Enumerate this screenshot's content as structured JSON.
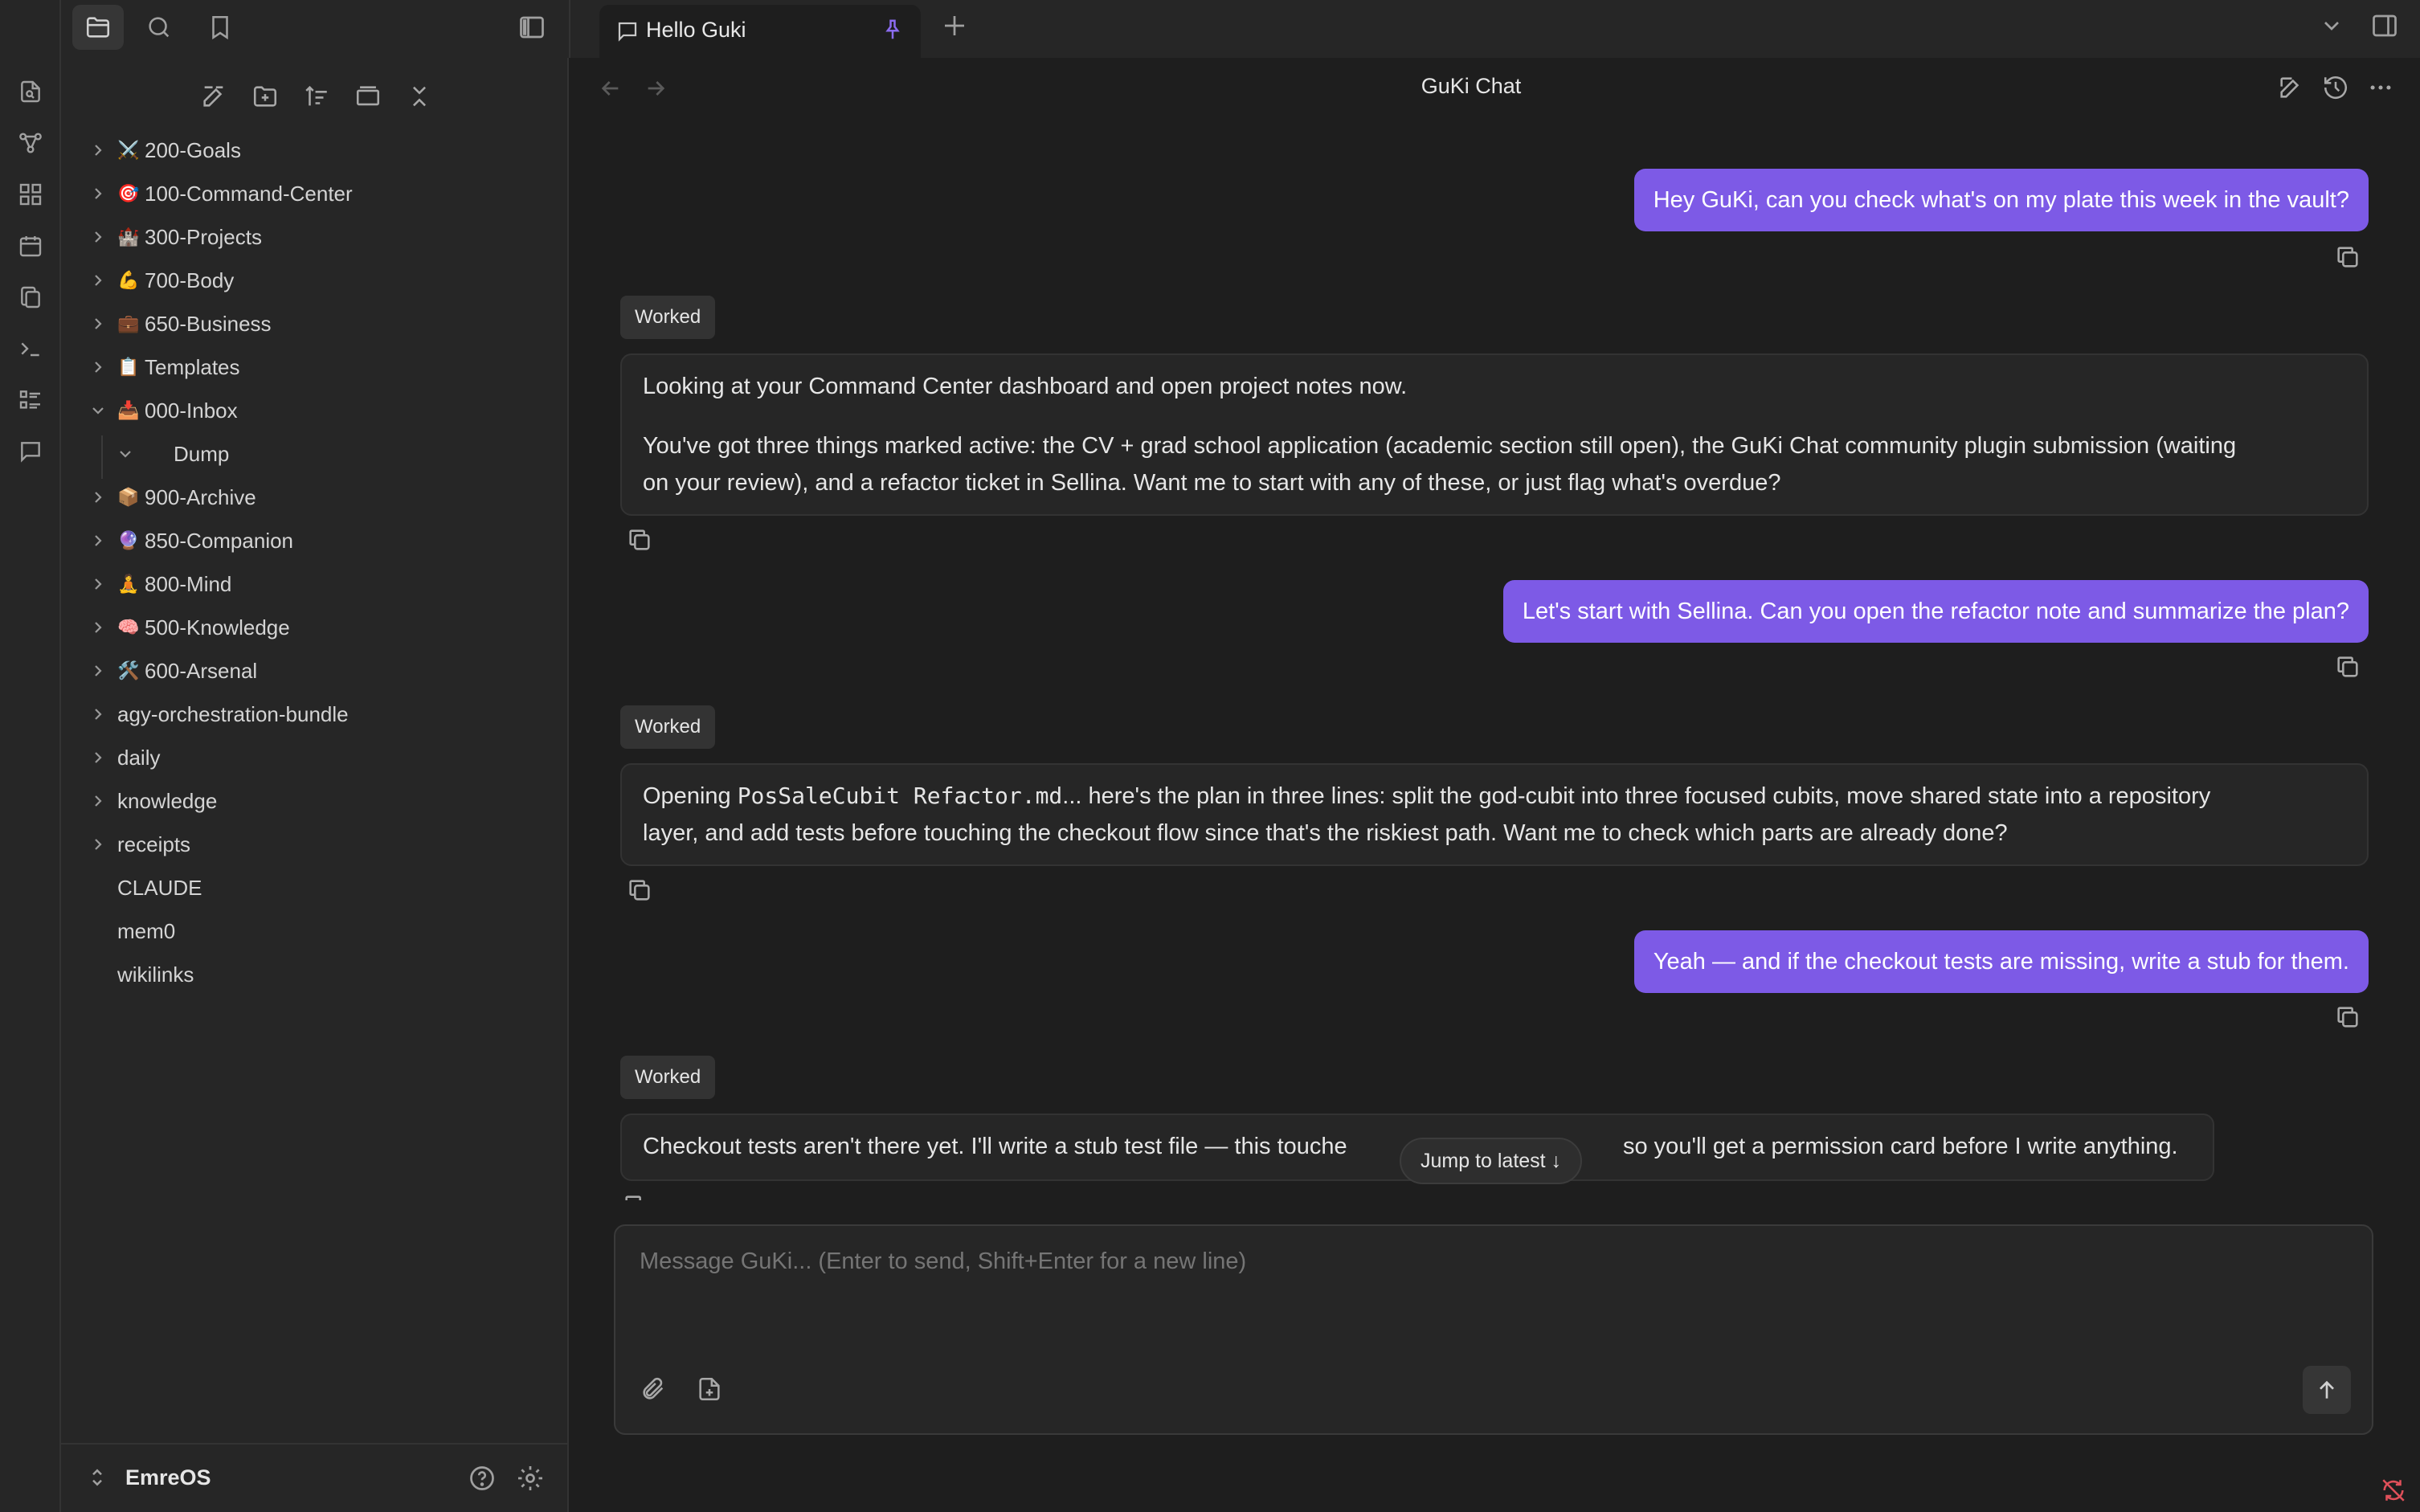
{
  "tabs": [
    {
      "label": "Hello Guki",
      "pinned": true
    }
  ],
  "header": {
    "title": "GuKi Chat"
  },
  "sidebar": {
    "items": [
      {
        "emoji": "⚔️",
        "label": "200-Goals",
        "expanded": false
      },
      {
        "emoji": "🎯",
        "label": "100-Command-Center",
        "expanded": false
      },
      {
        "emoji": "🏰",
        "label": "300-Projects",
        "expanded": false
      },
      {
        "emoji": "💪",
        "label": "700-Body",
        "expanded": false
      },
      {
        "emoji": "💼",
        "label": "650-Business",
        "expanded": false
      },
      {
        "emoji": "📋",
        "label": "Templates",
        "expanded": false
      },
      {
        "emoji": "📥",
        "label": "000-Inbox",
        "expanded": true
      },
      {
        "emoji": "",
        "label": "Dump",
        "expanded": true,
        "child": true
      },
      {
        "emoji": "📦",
        "label": "900-Archive",
        "expanded": false
      },
      {
        "emoji": "🔮",
        "label": "850-Companion",
        "expanded": false
      },
      {
        "emoji": "🧘",
        "label": "800-Mind",
        "expanded": false
      },
      {
        "emoji": "🧠",
        "label": "500-Knowledge",
        "expanded": false
      },
      {
        "emoji": "🛠️",
        "label": "600-Arsenal",
        "expanded": false
      },
      {
        "emoji": "",
        "label": "agy-orchestration-bundle",
        "expanded": false
      },
      {
        "emoji": "",
        "label": "daily",
        "expanded": false
      },
      {
        "emoji": "",
        "label": "knowledge",
        "expanded": false
      },
      {
        "emoji": "",
        "label": "receipts",
        "expanded": false
      },
      {
        "emoji": "",
        "label": "CLAUDE",
        "file": true
      },
      {
        "emoji": "",
        "label": "mem0",
        "file": true
      },
      {
        "emoji": "",
        "label": "wikilinks",
        "file": true
      }
    ]
  },
  "vault": {
    "name": "EmreOS"
  },
  "chat": {
    "messages": [
      {
        "role": "user",
        "text": "Hey GuKi, can you check what's on my plate this week in the vault?"
      },
      {
        "role": "assistant",
        "badge": "Worked",
        "p1": "Looking at your Command Center dashboard and open project notes now.",
        "p2a": "You've got three things marked active: the CV + grad school application (academic section still open), the GuKi Chat community plugin submission (waiting",
        "p2b": "on your review), and a refactor ticket in Sellina. Want me to start with any of these, or just flag what's overdue?"
      },
      {
        "role": "user",
        "text": "Let's start with Sellina. Can you open the refactor note and summarize the plan?"
      },
      {
        "role": "assistant",
        "badge": "Worked",
        "pre": "Opening ",
        "code": "PosSaleCubit Refactor.md",
        "post": "... here's the plan in three lines: split the god-cubit into three focused cubits, move shared state into a repository",
        "line2": "layer, and add tests before touching the checkout flow since that's the riskiest path. Want me to check which parts are already done?"
      },
      {
        "role": "user",
        "text": "Yeah — and if the checkout tests are missing, write a stub for them."
      },
      {
        "role": "assistant",
        "badge": "Worked",
        "left": "Checkout tests aren't there yet. I'll write a stub test file — this touche",
        "right": "so you'll get a permission card before I write anything."
      }
    ],
    "jump_label": "Jump to latest ↓"
  },
  "composer": {
    "placeholder": "Message GuKi... (Enter to send, Shift+Enter for a new line)"
  },
  "colors": {
    "accent": "#7d5ae6",
    "bg": "#1e1e1e",
    "panel": "#262626"
  }
}
